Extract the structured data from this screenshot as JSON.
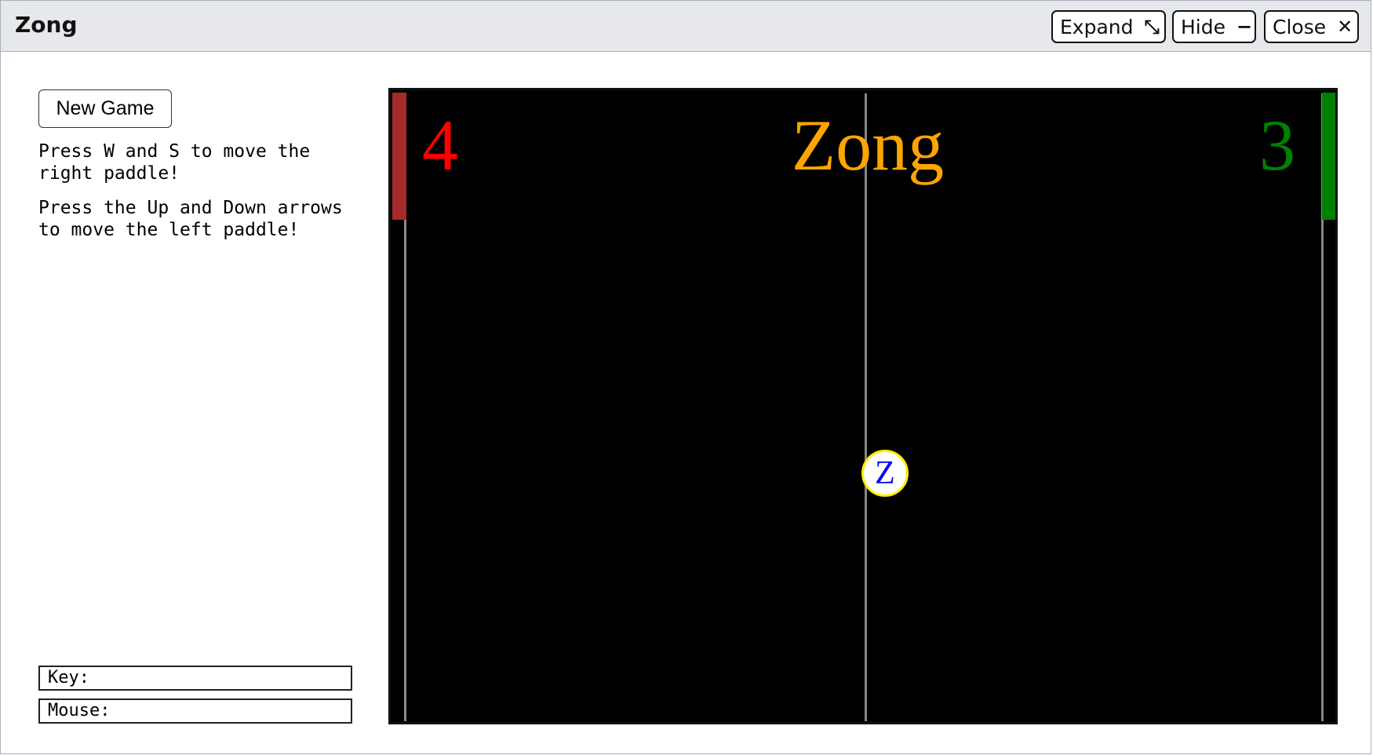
{
  "window": {
    "title": "Zong",
    "buttons": {
      "expand_label": "Expand",
      "hide_label": "Hide",
      "close_label": "Close"
    }
  },
  "sidebar": {
    "new_game_label": "New Game",
    "instructions": [
      "Press W and S to move the right paddle!",
      "Press the Up and Down arrows to move the left paddle!"
    ],
    "key_label": "Key:",
    "key_value": "",
    "mouse_label": "Mouse:",
    "mouse_value": ""
  },
  "game": {
    "title": "Zong",
    "score_left": "4",
    "score_right": "3",
    "ball_letter": "Z",
    "colors": {
      "background": "#000000",
      "title": "#ffa500",
      "score_left": "#ff0000",
      "score_right": "#008000",
      "paddle_left": "#a52a2a",
      "paddle_right": "#008000",
      "ball_fill": "#ffffff",
      "ball_border": "#ffee00",
      "ball_letter": "#0000ff"
    }
  }
}
